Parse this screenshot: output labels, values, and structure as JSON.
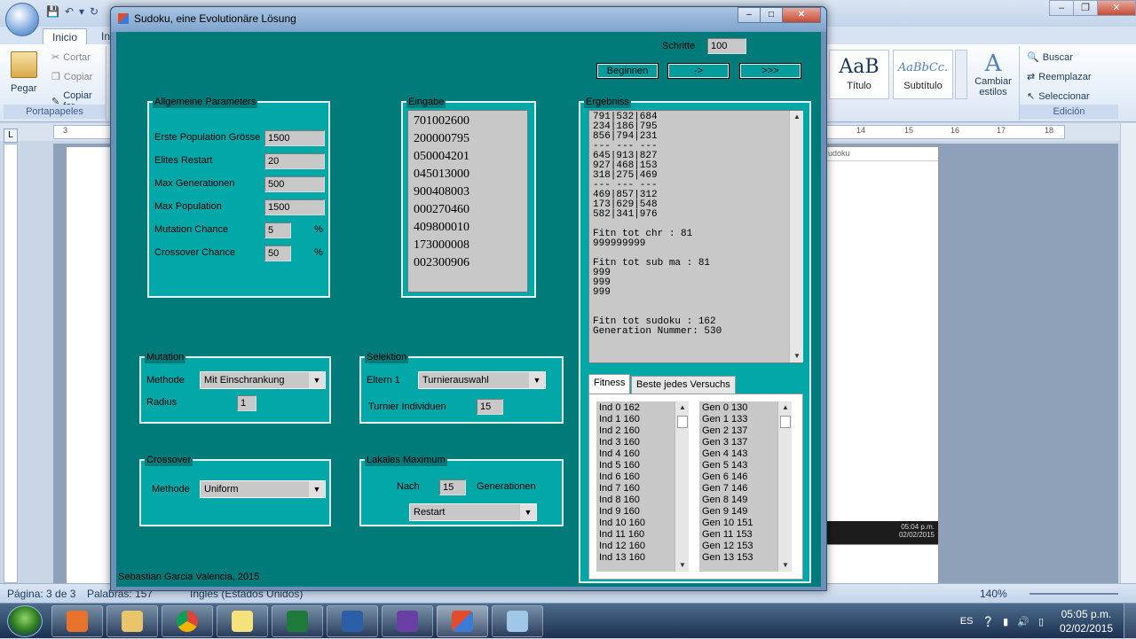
{
  "word": {
    "tabs": [
      "Inicio",
      "In"
    ],
    "clipboard": {
      "paste": "Pegar",
      "cut": "Cortar",
      "copy": "Copiar",
      "format_copy": "Copiar for",
      "group": "Portapapeles"
    },
    "styles": [
      {
        "sample": "AaB",
        "name": "Título"
      },
      {
        "sample": "AaBbCc.",
        "name": "Subtítulo"
      }
    ],
    "change_styles": "Cambiar estilos",
    "editing": {
      "find": "Buscar",
      "replace": "Reemplazar",
      "select": "Seleccionar",
      "group": "Edición"
    },
    "ruler_marks": [
      "3",
      "14",
      "15",
      "16",
      "17",
      "18"
    ],
    "search_snippet": "udoku",
    "status": {
      "page": "Página: 3 de 3",
      "words": "Palabras: 157",
      "language": "Inglés (Estados Unidos)",
      "zoom": "140%"
    }
  },
  "taskbar": {
    "language": "ES",
    "time": "05:05 p.m.",
    "date": "02/02/2015",
    "thumb_time": "05:04 p.m.",
    "thumb_date": "02/02/2015"
  },
  "app": {
    "title": "Sudoku, eine Evolutionäre Lösung",
    "schritte_label": "Schritte",
    "schritte_value": "100",
    "buttons": {
      "begin": "Beginnen",
      "step": "->",
      "run": ">>>"
    },
    "general": {
      "title": "Allgemeine Parameters",
      "rows": [
        {
          "label": "Erste Population Grösse",
          "value": "1500",
          "unit": ""
        },
        {
          "label": "Elites Restart",
          "value": "20",
          "unit": ""
        },
        {
          "label": "Max Generationen",
          "value": "500",
          "unit": ""
        },
        {
          "label": "Max Population",
          "value": "1500",
          "unit": ""
        },
        {
          "label": "Mutation Chance",
          "value": "5",
          "unit": "%"
        },
        {
          "label": "Crossover Chance",
          "value": "50",
          "unit": "%"
        }
      ]
    },
    "input": {
      "title": "Eingabe",
      "lines": [
        "701002600",
        "200000795",
        "050004201",
        "045013000",
        "900408003",
        "000270460",
        "409800010",
        "173000008",
        "002300906"
      ]
    },
    "result": {
      "title": "Ergebniss",
      "text": "791|532|684\n234|186|795\n856|794|231\n--- --- ---\n645|913|827\n927|468|153\n318|275|469\n--- --- ---\n469|857|312\n173|629|548\n582|341|976\n\nFitn tot chr : 81\n999999999\n\nFitn tot sub ma : 81\n999\n999\n999\n\n\nFitn tot sudoku : 162\nGeneration Nummer: 530"
    },
    "mutation": {
      "title": "Mutation",
      "method_label": "Methode",
      "method_value": "Mit Einschrankung",
      "radius_label": "Radius",
      "radius_value": "1"
    },
    "selection": {
      "title": "Selektion",
      "parents_label": "Eltern 1",
      "parents_value": "Turnierauswahl",
      "tournament_label": "Turnier Individuen",
      "tournament_value": "15"
    },
    "crossover": {
      "title": "Crossover",
      "method_label": "Methode",
      "method_value": "Uniform"
    },
    "local_max": {
      "title": "Lakales Maximum",
      "after_label": "Nach",
      "after_value": "15",
      "gen_label": "Generationen",
      "action_value": "Restart"
    },
    "tabs": {
      "fitness": "Fitness",
      "best": "Beste jedes Versuchs"
    },
    "fitness_list": [
      "Ind 0 162",
      "Ind 1 160",
      "Ind 2 160",
      "Ind 3 160",
      "Ind 4 160",
      "Ind 5 160",
      "Ind 6 160",
      "Ind 7 160",
      "Ind 8 160",
      "Ind 9 160",
      "Ind 10 160",
      "Ind 11 160",
      "Ind 12 160",
      "Ind 13 160"
    ],
    "gen_list": [
      "Gen 0 130",
      "Gen 1 133",
      "Gen 2 137",
      "Gen 3 137",
      "Gen 4 143",
      "Gen 5 143",
      "Gen 6 146",
      "Gen 7 146",
      "Gen 8 149",
      "Gen 9 149",
      "Gen 10 151",
      "Gen 11 153",
      "Gen 12 153",
      "Gen 13 153"
    ],
    "footer": "Sebastian Garcia Valencia, 2015"
  }
}
